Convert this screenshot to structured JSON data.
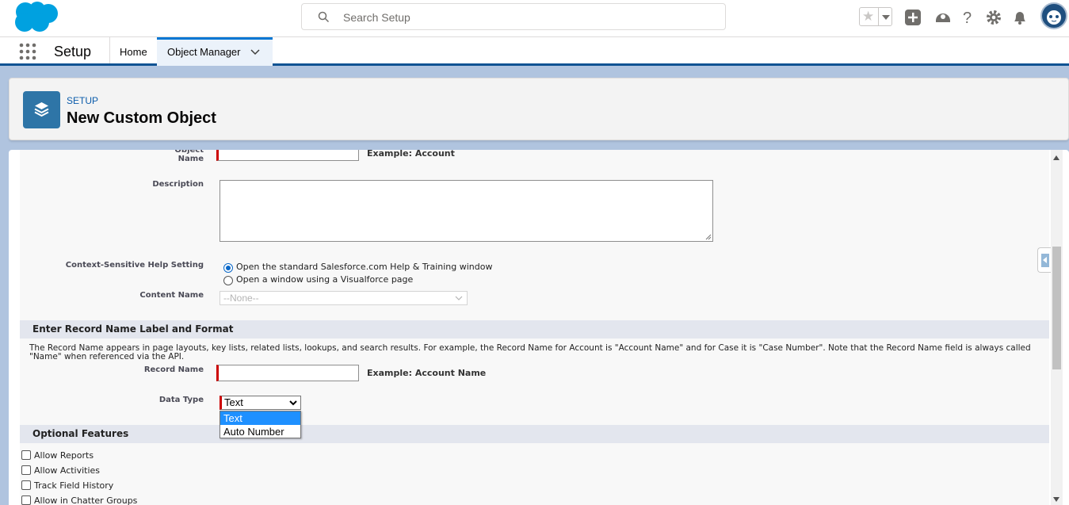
{
  "header": {
    "search_placeholder": "Search Setup",
    "icons": [
      "salesforce-cloud-logo",
      "search-icon",
      "favorites-star-icon",
      "global-actions-plus-icon",
      "trailhead-guidance-icon",
      "help-question-icon",
      "setup-gear-icon",
      "notifications-bell-icon",
      "user-avatar"
    ]
  },
  "context_bar": {
    "app_name": "Setup",
    "tabs": [
      {
        "label": "Home"
      },
      {
        "label": "Object Manager",
        "active": true
      }
    ]
  },
  "page_header": {
    "eyebrow": "SETUP",
    "title": "New Custom Object"
  },
  "form": {
    "object_name": {
      "label": "Object Name",
      "value": "",
      "example": "Example:  Account"
    },
    "description": {
      "label": "Description",
      "value": ""
    },
    "help_setting": {
      "label": "Context-Sensitive Help Setting",
      "options": [
        {
          "label": "Open the standard Salesforce.com Help & Training window",
          "checked": true
        },
        {
          "label": "Open a window using a Visualforce page",
          "checked": false
        }
      ]
    },
    "content_name": {
      "label": "Content Name",
      "value": "--None--",
      "disabled": true
    }
  },
  "record_name_section": {
    "title": "Enter Record Name Label and Format",
    "help": "The Record Name appears in page layouts, key lists, related lists, lookups, and search results. For example, the Record Name for Account is \"Account Name\" and for Case it is \"Case Number\". Note that the Record Name field is always called \"Name\" when referenced via the API.",
    "record_name": {
      "label": "Record Name",
      "value": "",
      "example": "Example:  Account Name"
    },
    "data_type": {
      "label": "Data Type",
      "selected": "Text",
      "options": [
        "Text",
        "Auto Number"
      ],
      "highlighted": "Text"
    }
  },
  "optional_features": {
    "title": "Optional Features",
    "items": [
      {
        "label": "Allow Reports",
        "checked": false
      },
      {
        "label": "Allow Activities",
        "checked": false
      },
      {
        "label": "Track Field History",
        "checked": false
      },
      {
        "label": "Allow in Chatter Groups",
        "checked": false
      }
    ]
  },
  "colors": {
    "brand_blue": "#0176d3",
    "icon_bg": "#2e75a7",
    "required_marker": "#cc0000",
    "section_bar": "#e3e6ee"
  }
}
